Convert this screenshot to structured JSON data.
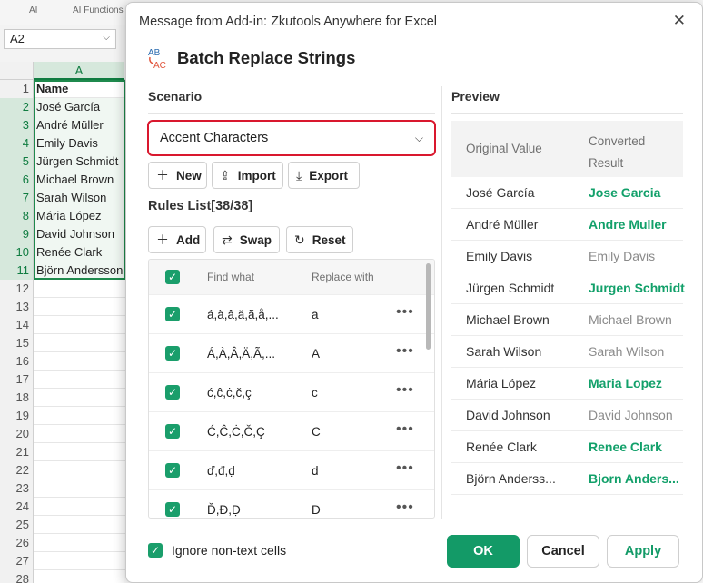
{
  "excel": {
    "tabs": [
      "AI",
      "AI Functions"
    ],
    "name_box": "A2",
    "column": "A",
    "rows": [
      {
        "num": "1",
        "value": "Name"
      },
      {
        "num": "2",
        "value": "José García"
      },
      {
        "num": "3",
        "value": "André Müller"
      },
      {
        "num": "4",
        "value": "Emily Davis"
      },
      {
        "num": "5",
        "value": "Jürgen Schmidt"
      },
      {
        "num": "6",
        "value": "Michael Brown"
      },
      {
        "num": "7",
        "value": "Sarah Wilson"
      },
      {
        "num": "8",
        "value": "Mária López"
      },
      {
        "num": "9",
        "value": "David Johnson"
      },
      {
        "num": "10",
        "value": "Renée Clark"
      },
      {
        "num": "11",
        "value": "Björn Andersson"
      },
      {
        "num": "12",
        "value": ""
      },
      {
        "num": "13",
        "value": ""
      },
      {
        "num": "14",
        "value": ""
      },
      {
        "num": "15",
        "value": ""
      },
      {
        "num": "16",
        "value": ""
      },
      {
        "num": "17",
        "value": ""
      },
      {
        "num": "18",
        "value": ""
      },
      {
        "num": "19",
        "value": ""
      },
      {
        "num": "20",
        "value": ""
      },
      {
        "num": "21",
        "value": ""
      },
      {
        "num": "22",
        "value": ""
      },
      {
        "num": "23",
        "value": ""
      },
      {
        "num": "24",
        "value": ""
      },
      {
        "num": "25",
        "value": ""
      },
      {
        "num": "26",
        "value": ""
      },
      {
        "num": "27",
        "value": ""
      },
      {
        "num": "28",
        "value": ""
      }
    ]
  },
  "dialog": {
    "window_title": "Message from Add-in: Zkutools Anywhere for Excel",
    "close_icon": "✕",
    "app_title": "Batch Replace Strings",
    "logo_text": {
      "top": "AB",
      "bottom": "AC"
    },
    "scenario_label": "Scenario",
    "scenario_value": "Accent Characters",
    "scenario_buttons": {
      "new": "New",
      "import": "Import",
      "export": "Export"
    },
    "rules_label": "Rules List[38/38]",
    "rules_buttons": {
      "add": "Add",
      "swap": "Swap",
      "reset": "Reset"
    },
    "rules_header": {
      "find": "Find what",
      "replace": "Replace with"
    },
    "rules": [
      {
        "find": "á,à,â,ä,ã,å,...",
        "replace": "a",
        "checked": true
      },
      {
        "find": "Á,À,Â,Ä,Ã,...",
        "replace": "A",
        "checked": true
      },
      {
        "find": "ć,ĉ,ċ,č,ç",
        "replace": "c",
        "checked": true
      },
      {
        "find": "Ć,Ĉ,Ċ,Č,Ç",
        "replace": "C",
        "checked": true
      },
      {
        "find": "ď,đ,ḍ",
        "replace": "d",
        "checked": true
      },
      {
        "find": "Ď,Đ,Ḍ",
        "replace": "D",
        "checked": true
      }
    ],
    "preview_label": "Preview",
    "preview_header": {
      "original": "Original Value",
      "converted": "Converted Result"
    },
    "preview": [
      {
        "original": "José García",
        "converted": "Jose Garcia",
        "changed": true
      },
      {
        "original": "André Müller",
        "converted": "Andre Muller",
        "changed": true
      },
      {
        "original": "Emily Davis",
        "converted": "Emily Davis",
        "changed": false
      },
      {
        "original": "Jürgen Schmidt",
        "converted": "Jurgen Schmidt",
        "changed": true
      },
      {
        "original": "Michael Brown",
        "converted": "Michael Brown",
        "changed": false
      },
      {
        "original": "Sarah Wilson",
        "converted": "Sarah Wilson",
        "changed": false
      },
      {
        "original": "Mária López",
        "converted": "Maria Lopez",
        "changed": true
      },
      {
        "original": "David Johnson",
        "converted": "David Johnson",
        "changed": false
      },
      {
        "original": "Renée Clark",
        "converted": "Renee Clark",
        "changed": true
      },
      {
        "original": "Björn Anderss...",
        "converted": "Bjorn Anders...",
        "changed": true
      }
    ],
    "ignore_label": "Ignore non-text cells",
    "ignore_checked": true,
    "footer_buttons": {
      "ok": "OK",
      "cancel": "Cancel",
      "apply": "Apply"
    }
  },
  "colors": {
    "accent": "#139a67",
    "highlight_border": "#d9182e",
    "excel_green": "#107c41"
  }
}
